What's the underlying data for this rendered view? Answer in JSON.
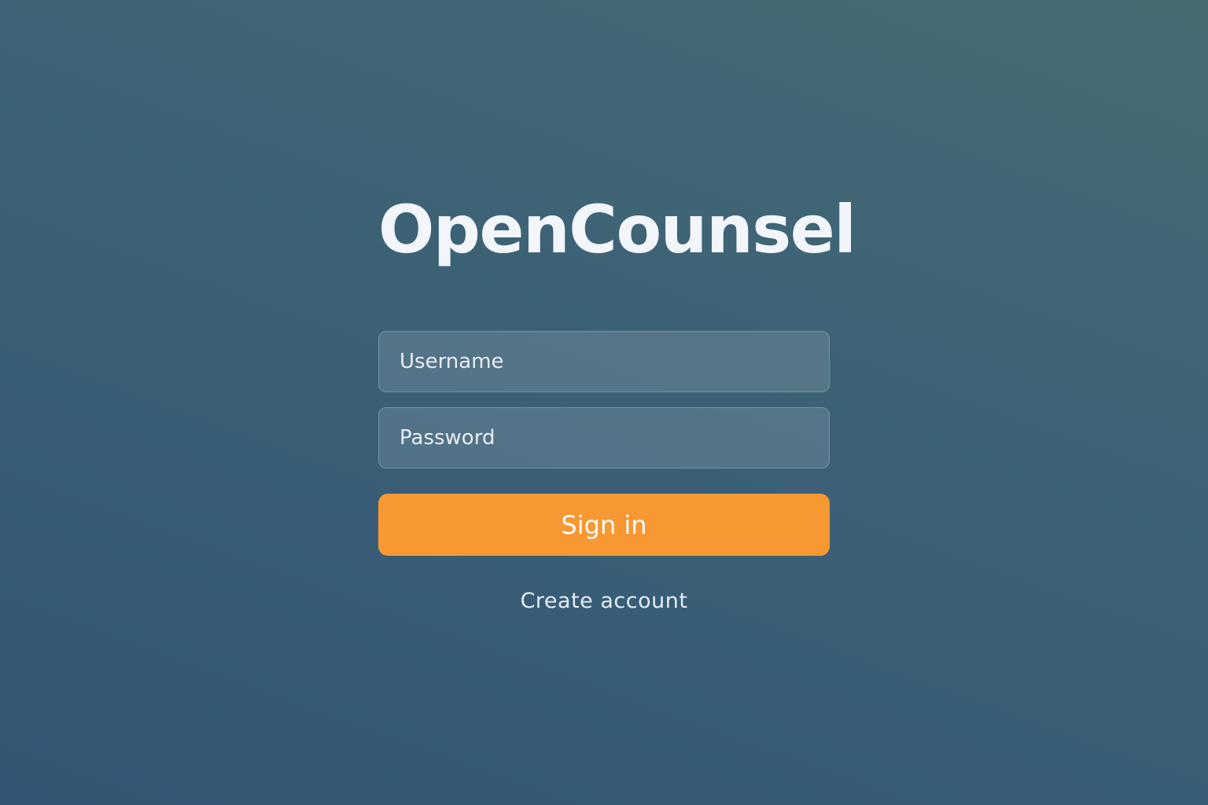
{
  "app": {
    "title": "OpenCounsel"
  },
  "login_form": {
    "username": {
      "placeholder": "Username",
      "value": ""
    },
    "password": {
      "placeholder": "Password",
      "value": ""
    },
    "sign_in_label": "Sign in",
    "create_account_label": "Create account"
  },
  "colors": {
    "background_start": "#325673",
    "background_end": "#466c72",
    "accent_button": "#f89833",
    "text": "#f2f6fa"
  }
}
